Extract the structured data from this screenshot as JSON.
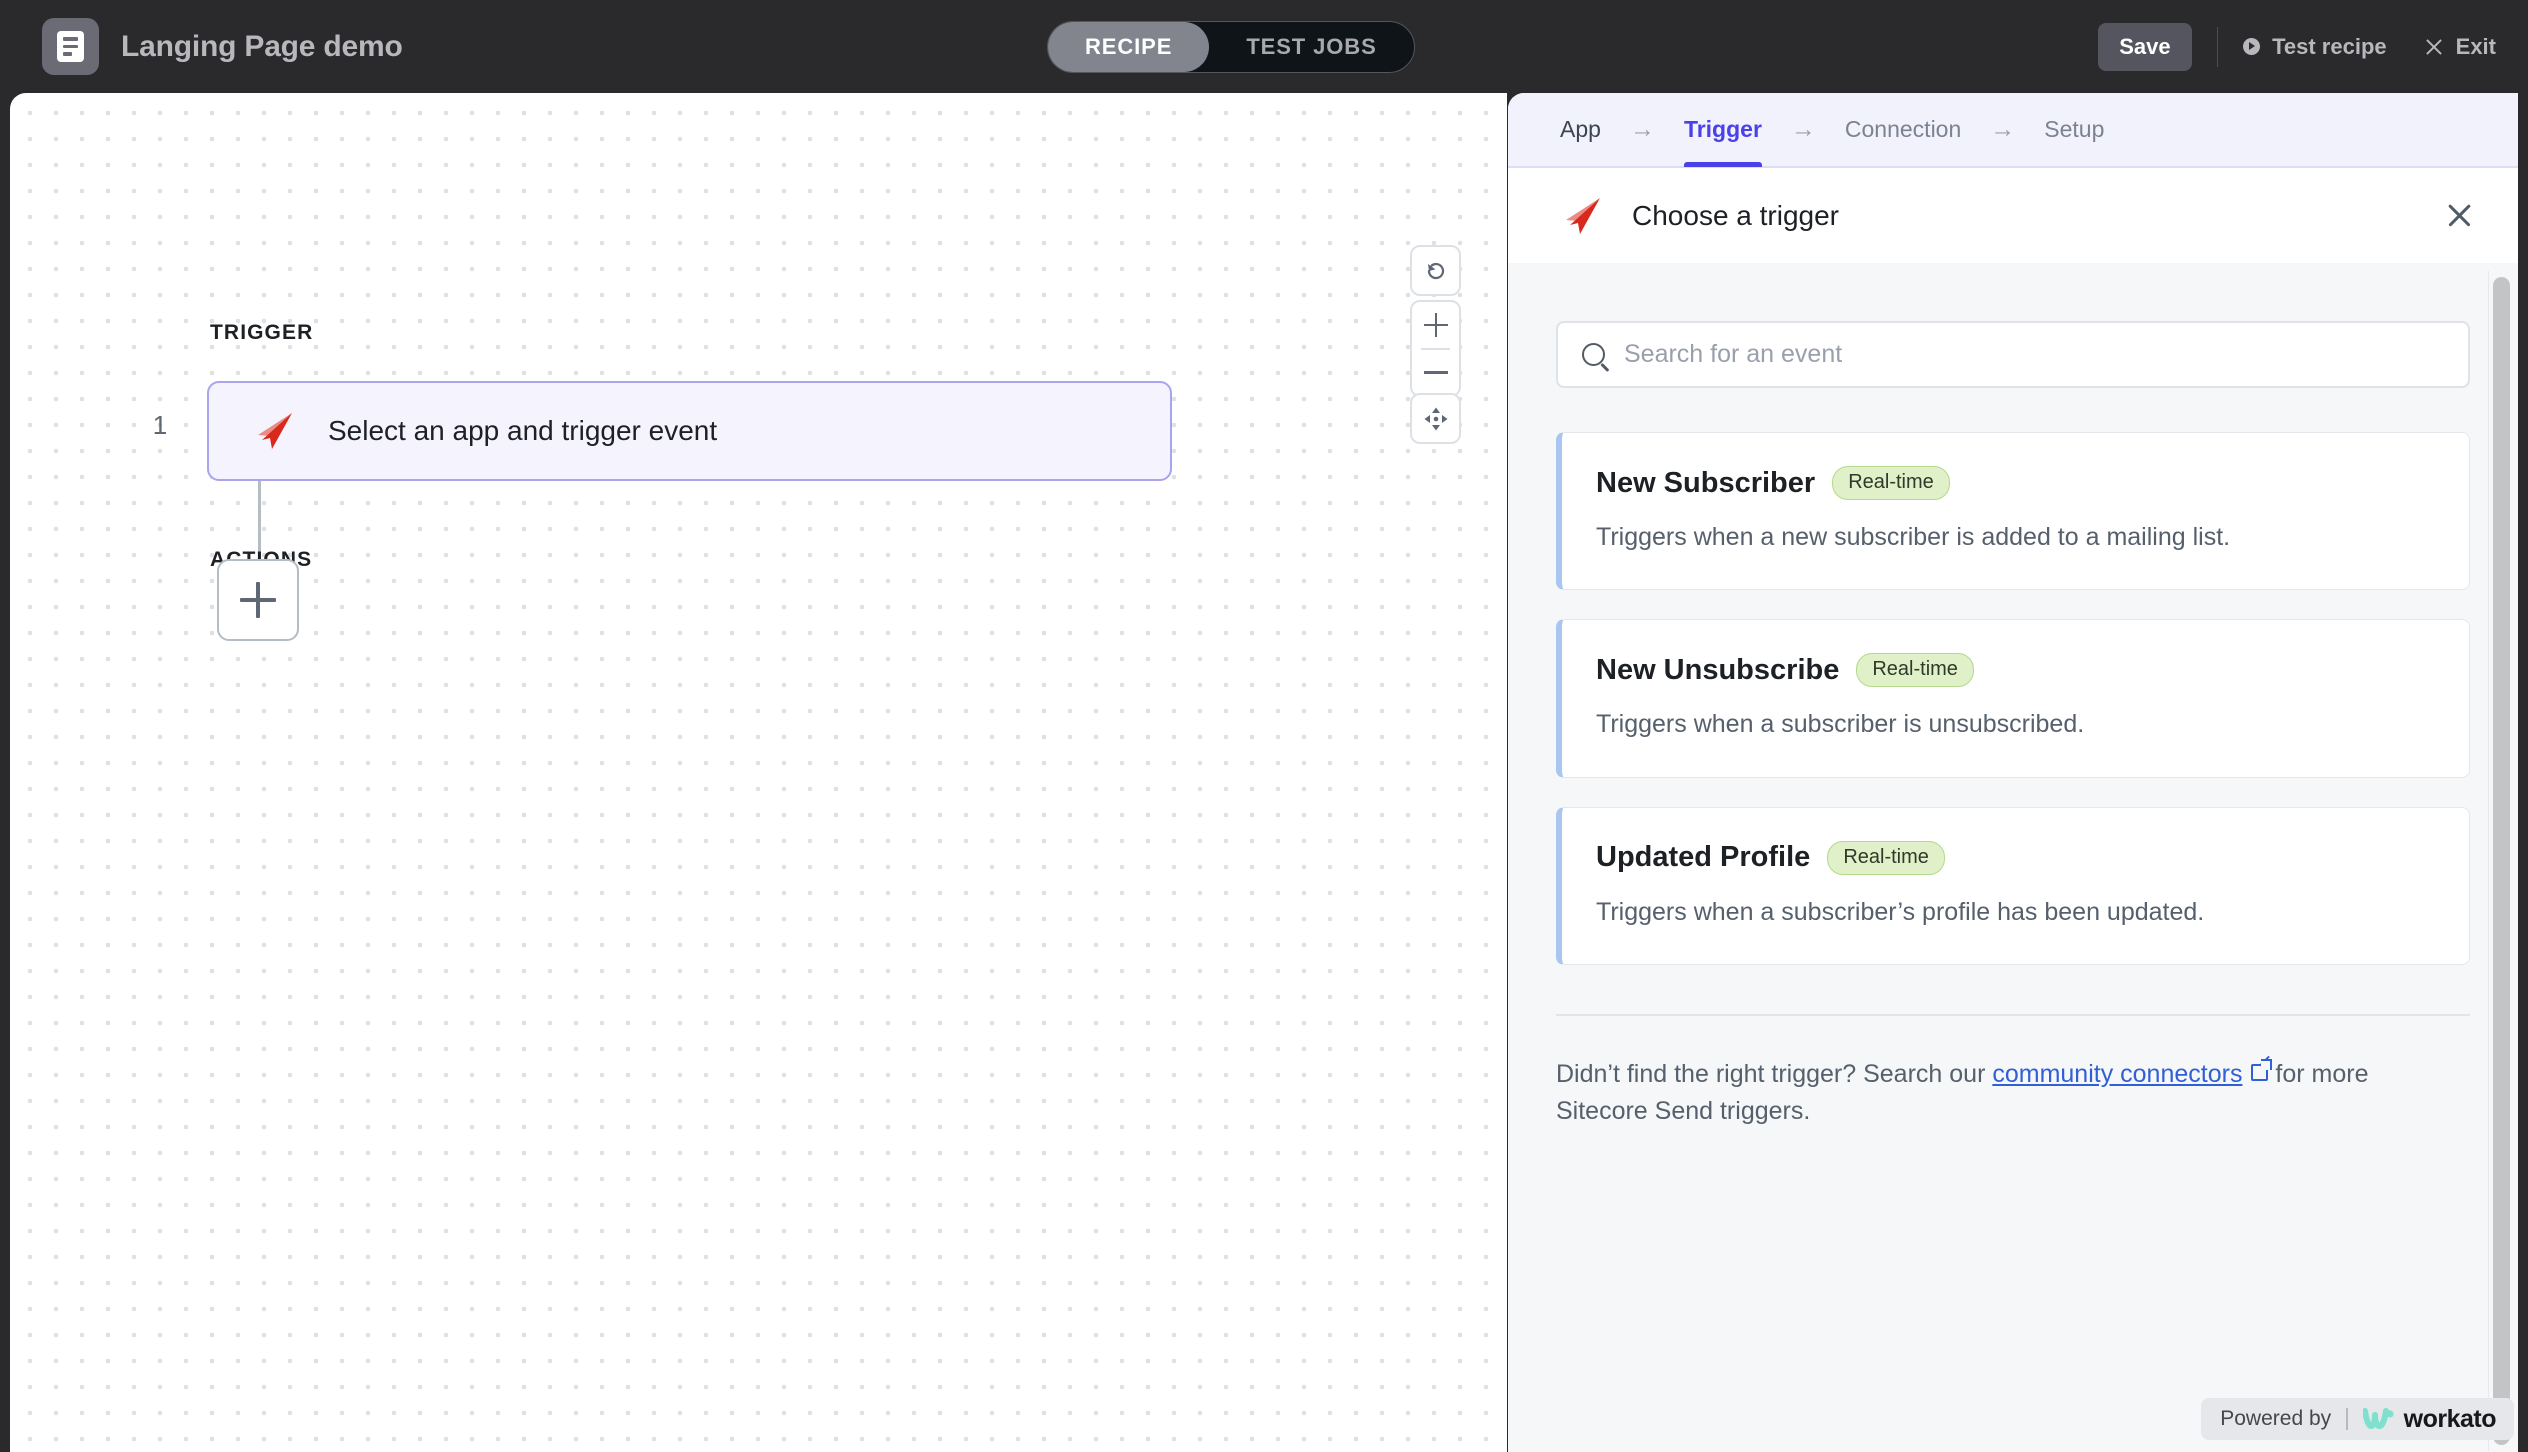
{
  "topbar": {
    "app_icon": "recipe-document-icon",
    "title": "Langing Page demo",
    "tabs": [
      {
        "label": "RECIPE",
        "active": true
      },
      {
        "label": "TEST JOBS",
        "active": false
      }
    ],
    "save_label": "Save",
    "test_recipe_label": "Test recipe",
    "exit_label": "Exit"
  },
  "canvas": {
    "trigger_section_label": "TRIGGER",
    "actions_section_label": "ACTIONS",
    "step_number": "1",
    "trigger_placeholder": "Select an app and trigger event",
    "add_action_label": "+",
    "controls": {
      "reset": "reset-view",
      "zoom_in": "+",
      "zoom_out": "−",
      "fit": "fit-to-screen"
    }
  },
  "panel": {
    "breadcrumb": [
      {
        "label": "App",
        "state": "done"
      },
      {
        "label": "Trigger",
        "state": "active"
      },
      {
        "label": "Connection",
        "state": "upcoming"
      },
      {
        "label": "Setup",
        "state": "upcoming"
      }
    ],
    "breadcrumb_arrow": "→",
    "title": "Choose a trigger",
    "close_label": "×",
    "search": {
      "placeholder": "Search for an event",
      "value": ""
    },
    "triggers": [
      {
        "name": "New Subscriber",
        "badge": "Real-time",
        "description": "Triggers when a new subscriber is added to a mailing list."
      },
      {
        "name": "New Unsubscribe",
        "badge": "Real-time",
        "description": "Triggers when a subscriber is unsubscribed."
      },
      {
        "name": "Updated Profile",
        "badge": "Real-time",
        "description": "Triggers when a subscriber’s profile has been updated."
      }
    ],
    "footer": {
      "before_link": "Didn’t find the right trigger? Search our ",
      "link_text": "community connectors",
      "after_link": " for more Sitecore Send triggers."
    }
  },
  "powered_by": {
    "label": "Powered by",
    "brand": "workato"
  },
  "colors": {
    "accent_purple": "#4a41e8",
    "card_accent_blue": "#a9c6f0",
    "badge_green_bg": "#e0f0c8",
    "badge_green_border": "#b5d98a",
    "link_blue": "#3160d6",
    "brand_red": "#d9291c",
    "workato_teal": "#7fe0cd",
    "topbar_bg": "#2a2a2c"
  }
}
